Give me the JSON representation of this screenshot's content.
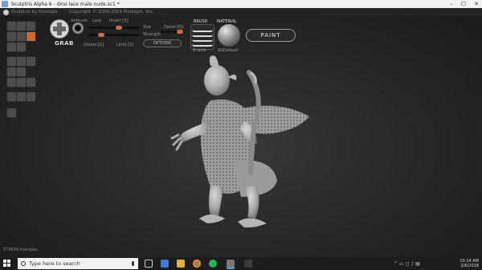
{
  "window": {
    "title": "Sculptris Alpha 6 - dino lace male nude.sc1 *",
    "controls": [
      "–",
      "☐",
      "✕"
    ]
  },
  "appbar": {
    "brand": "Sculptris by Pixologic",
    "copyright": "Copyright © 2009-2015 Pixologic, Inc."
  },
  "tool": {
    "name": "GRAB",
    "airbrush": "Airbrush",
    "lazy": "Lazy",
    "invert": "Invert [X]",
    "global": "Global [G]",
    "limit": "Limit [S]"
  },
  "sliders": {
    "size_label": "Size",
    "detail_label": "Detail [Q]",
    "strength_label": "Strength",
    "options_label": "OPTIONS"
  },
  "brush": {
    "header": "BRUSH",
    "enable": "Enable"
  },
  "material": {
    "header": "MATERIAL",
    "name": "SGDefault"
  },
  "paint_button": "PAINT",
  "status": {
    "triangles": "579434 triangles"
  },
  "taskbar": {
    "search_placeholder": "Type here to search",
    "time": "10:14 AM",
    "date": "2/6/2018",
    "colors": {
      "accent": "#d06a2a",
      "taskbar": "#1d1d1d"
    }
  }
}
